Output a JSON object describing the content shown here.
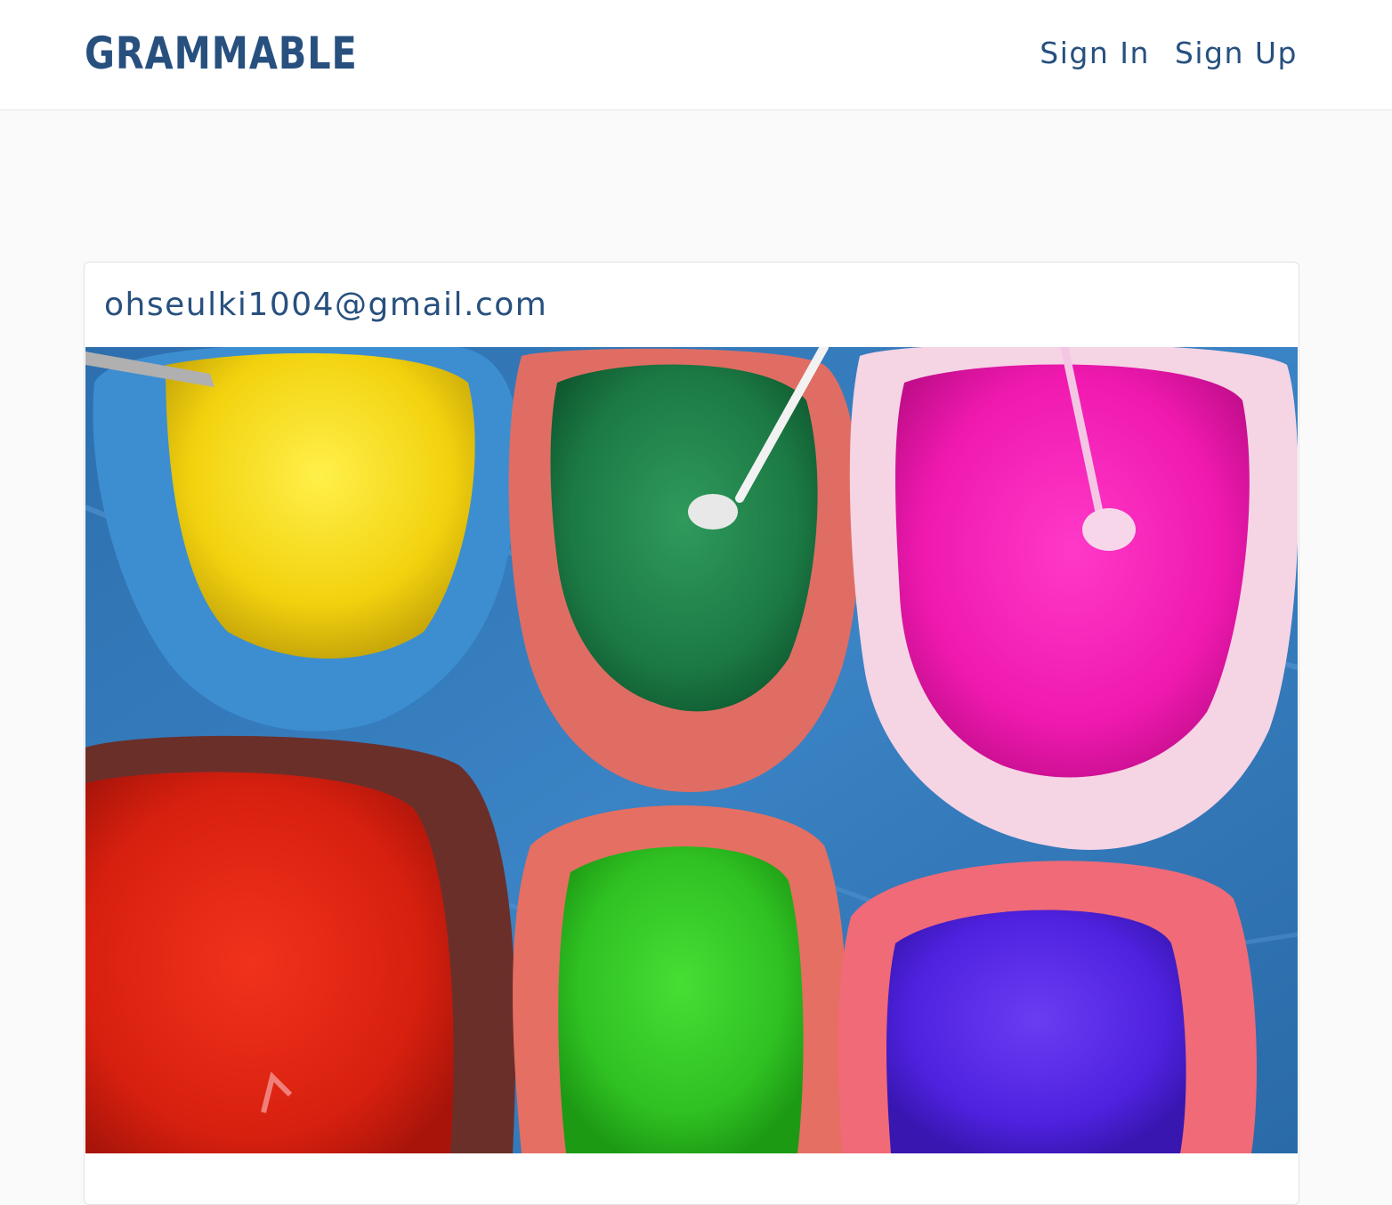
{
  "brand": "GRAMMABLE",
  "nav": {
    "sign_in": "Sign In",
    "sign_up": "Sign Up"
  },
  "post": {
    "user_email": "ohseulki1004@gmail.com",
    "image_description": "colorful powder pigments in bags"
  },
  "colors": {
    "brand": "#27507e",
    "page_bg": "#fafafa",
    "card_bg": "#ffffff"
  }
}
